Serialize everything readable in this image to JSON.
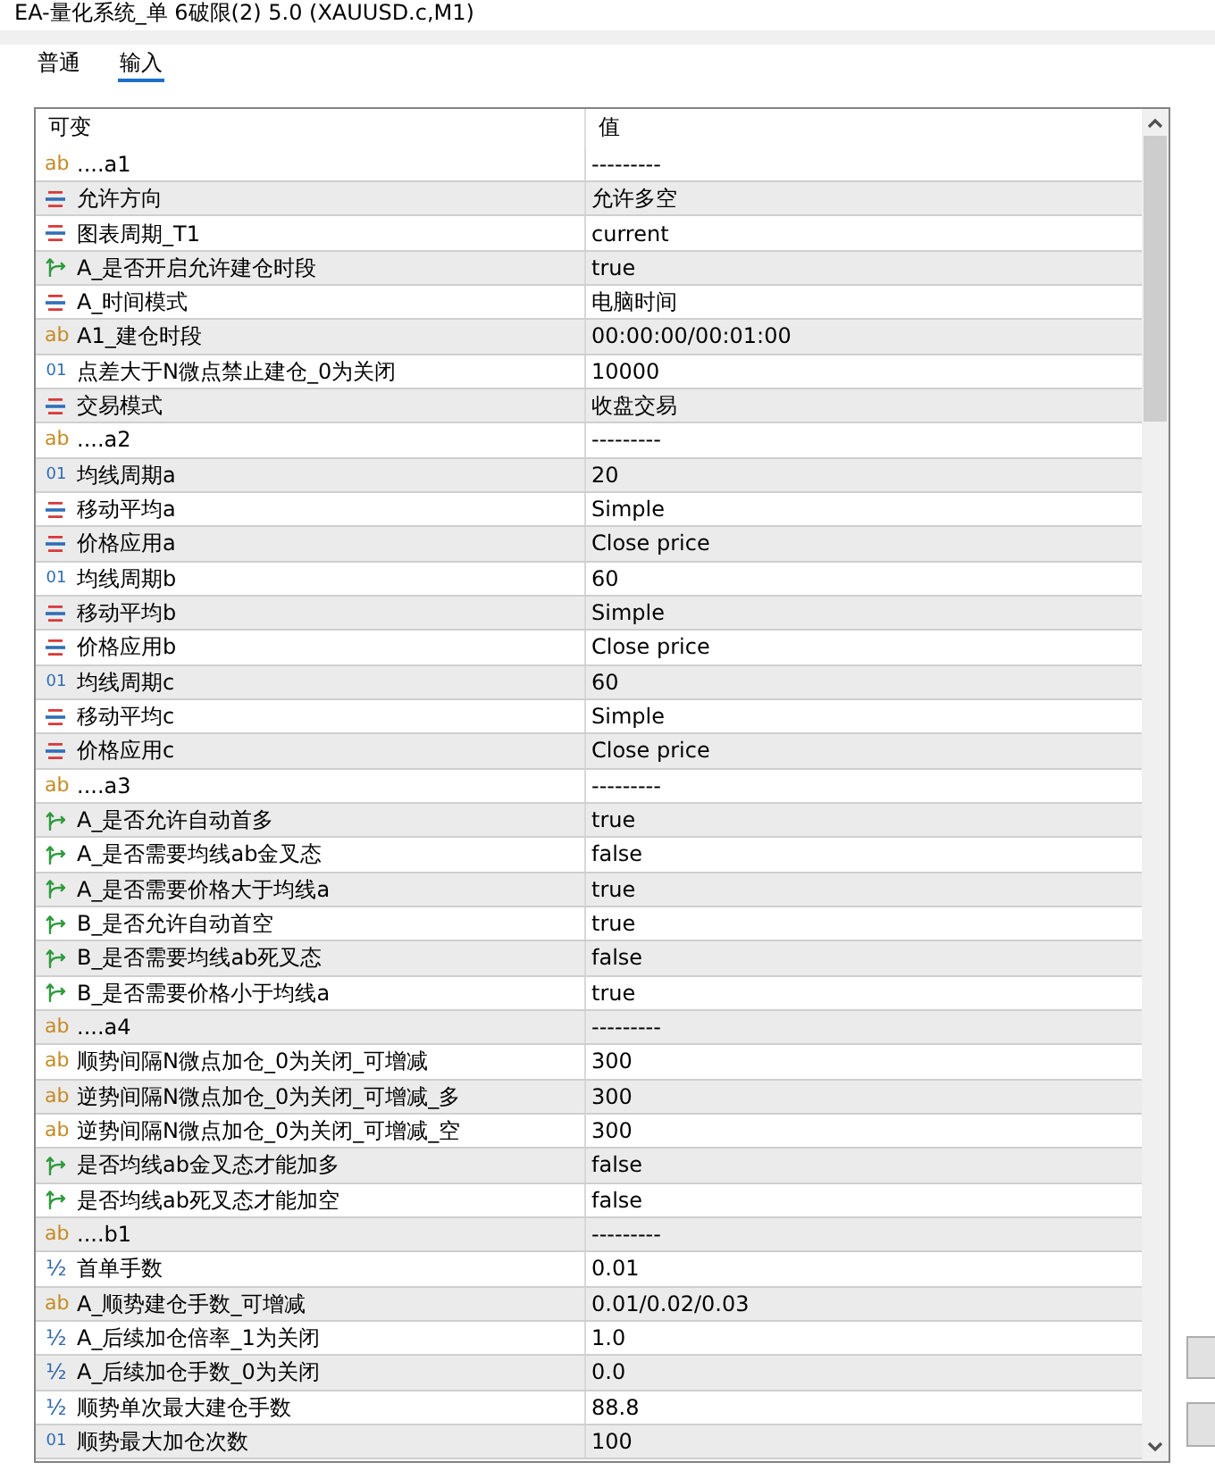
{
  "window": {
    "title": "EA-量化系统_单 6破限(2) 5.0 (XAUUSD.c,M1)"
  },
  "tabs": [
    {
      "label": "普通",
      "selected": false
    },
    {
      "label": "输入",
      "selected": true
    }
  ],
  "table": {
    "columns": [
      "可变",
      "值"
    ],
    "rows": [
      {
        "kind": "string",
        "type_code": "ab",
        "name": "....a1",
        "value": "---------"
      },
      {
        "kind": "enum",
        "name": "允许方向",
        "value": "允许多空"
      },
      {
        "kind": "enum",
        "name": "图表周期_T1",
        "value": "current"
      },
      {
        "kind": "bool",
        "name": "A_是否开启允许建仓时段",
        "value": "true"
      },
      {
        "kind": "enum",
        "name": "A_时间模式",
        "value": "电脑时间"
      },
      {
        "kind": "string",
        "type_code": "ab",
        "name": "A1_建仓时段",
        "value": "00:00:00/00:01:00"
      },
      {
        "kind": "int",
        "type_code": "01",
        "name": "点差大于N微点禁止建仓_0为关闭",
        "value": "10000"
      },
      {
        "kind": "enum",
        "name": "交易模式",
        "value": "收盘交易"
      },
      {
        "kind": "string",
        "type_code": "ab",
        "name": "....a2",
        "value": "---------"
      },
      {
        "kind": "int",
        "type_code": "01",
        "name": "均线周期a",
        "value": "20"
      },
      {
        "kind": "enum",
        "name": "移动平均a",
        "value": "Simple"
      },
      {
        "kind": "enum",
        "name": "价格应用a",
        "value": "Close price"
      },
      {
        "kind": "int",
        "type_code": "01",
        "name": "均线周期b",
        "value": "60"
      },
      {
        "kind": "enum",
        "name": "移动平均b",
        "value": "Simple"
      },
      {
        "kind": "enum",
        "name": "价格应用b",
        "value": "Close price"
      },
      {
        "kind": "int",
        "type_code": "01",
        "name": "均线周期c",
        "value": "60"
      },
      {
        "kind": "enum",
        "name": "移动平均c",
        "value": "Simple"
      },
      {
        "kind": "enum",
        "name": "价格应用c",
        "value": "Close price"
      },
      {
        "kind": "string",
        "type_code": "ab",
        "name": "....a3",
        "value": "---------"
      },
      {
        "kind": "bool",
        "name": "A_是否允许自动首多",
        "value": "true"
      },
      {
        "kind": "bool",
        "name": "A_是否需要均线ab金叉态",
        "value": "false"
      },
      {
        "kind": "bool",
        "name": "A_是否需要价格大于均线a",
        "value": "true"
      },
      {
        "kind": "bool",
        "name": "B_是否允许自动首空",
        "value": "true"
      },
      {
        "kind": "bool",
        "name": "B_是否需要均线ab死叉态",
        "value": "false"
      },
      {
        "kind": "bool",
        "name": "B_是否需要价格小于均线a",
        "value": "true"
      },
      {
        "kind": "string",
        "type_code": "ab",
        "name": "....a4",
        "value": "---------"
      },
      {
        "kind": "string",
        "type_code": "ab",
        "name": "顺势间隔N微点加仓_0为关闭_可增减",
        "value": "300"
      },
      {
        "kind": "string",
        "type_code": "ab",
        "name": "逆势间隔N微点加仓_0为关闭_可增减_多",
        "value": "300"
      },
      {
        "kind": "string",
        "type_code": "ab",
        "name": "逆势间隔N微点加仓_0为关闭_可增减_空",
        "value": "300"
      },
      {
        "kind": "bool",
        "name": "是否均线ab金叉态才能加多",
        "value": "false"
      },
      {
        "kind": "bool",
        "name": "是否均线ab死叉态才能加空",
        "value": "false"
      },
      {
        "kind": "string",
        "type_code": "ab",
        "name": "....b1",
        "value": "---------"
      },
      {
        "kind": "double",
        "type_code": "½",
        "name": "首单手数",
        "value": "0.01"
      },
      {
        "kind": "string",
        "type_code": "ab",
        "name": "A_顺势建仓手数_可增减",
        "value": "0.01/0.02/0.03"
      },
      {
        "kind": "double",
        "type_code": "½",
        "name": "A_后续加仓倍率_1为关闭",
        "value": "1.0"
      },
      {
        "kind": "double",
        "type_code": "½",
        "name": "A_后续加仓手数_0为关闭",
        "value": "0.0"
      },
      {
        "kind": "double",
        "type_code": "½",
        "name": "顺势单次最大建仓手数",
        "value": "88.8"
      },
      {
        "kind": "int",
        "type_code": "01",
        "name": "顺势最大加仓次数",
        "value": "100"
      }
    ]
  }
}
